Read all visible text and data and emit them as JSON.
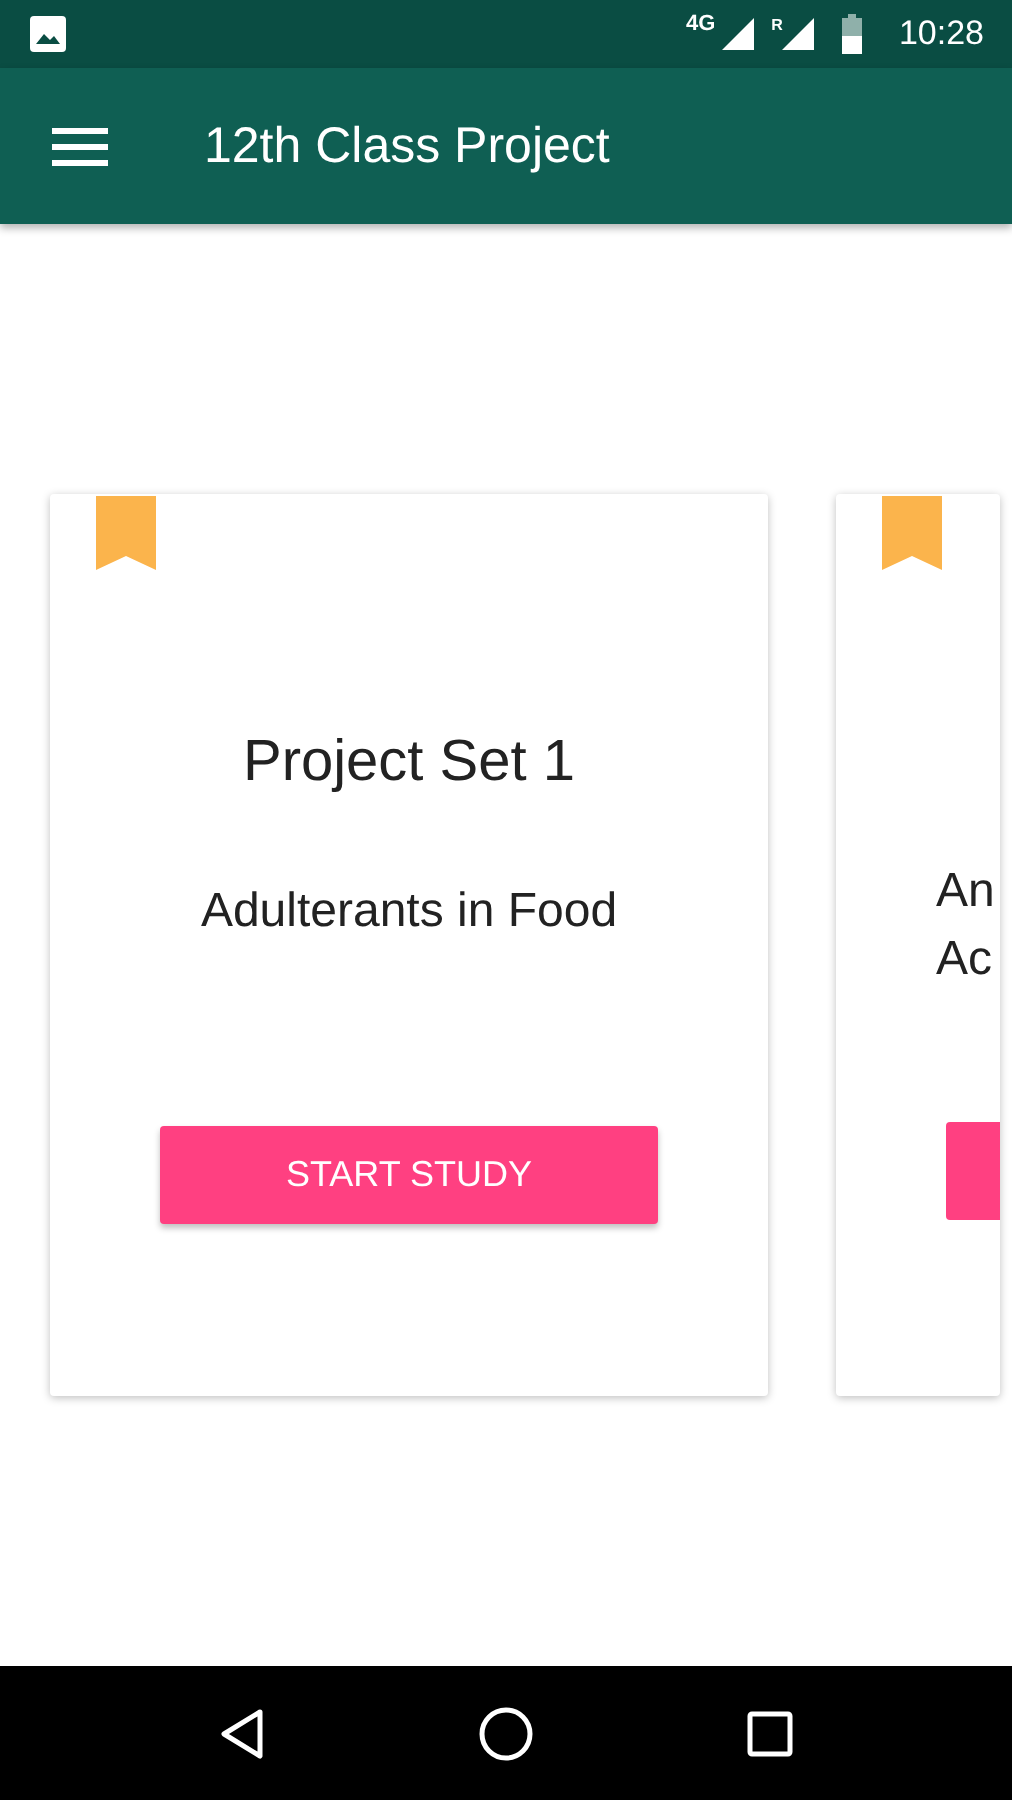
{
  "status_bar": {
    "time": "10:28",
    "network": "4G",
    "roaming": "R"
  },
  "app_bar": {
    "title": "12th Class Project"
  },
  "cards": [
    {
      "title": "Project Set 1",
      "subtitle_lines": [
        "Adulterants in Food"
      ],
      "button": "START STUDY"
    },
    {
      "subtitle_lines": [
        "An",
        "Ac"
      ]
    }
  ]
}
